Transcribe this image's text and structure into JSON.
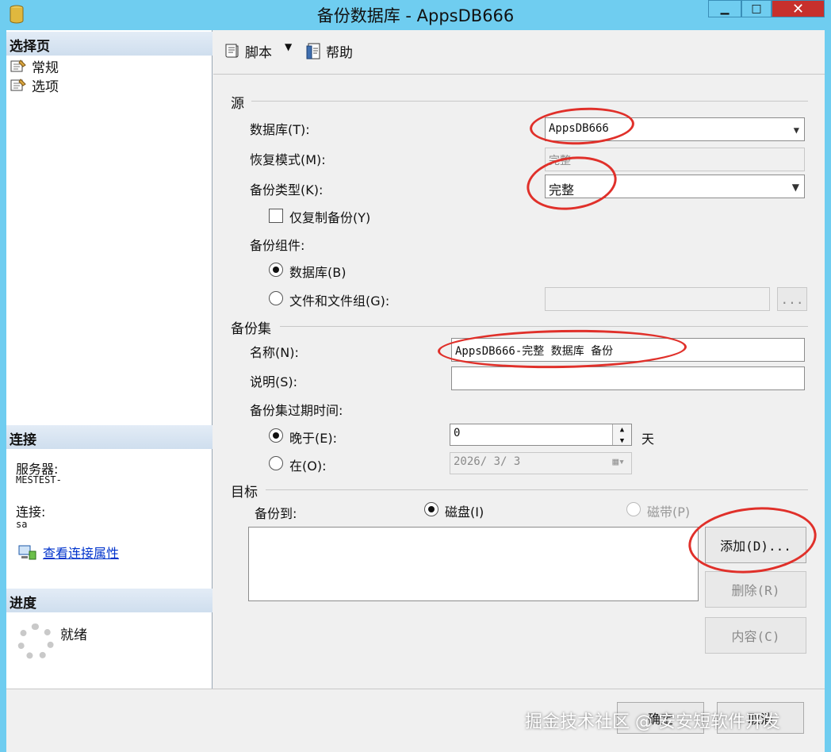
{
  "window": {
    "title": "备份数据库 - AppsDB666"
  },
  "left": {
    "select_page_header": "选择页",
    "nav": [
      {
        "label": "常规"
      },
      {
        "label": "选项"
      }
    ],
    "connection_header": "连接",
    "server_label": "服务器:",
    "server_value": "MESTEST-",
    "conn_label": "连接:",
    "conn_value": "sa",
    "view_conn_props": "查看连接属性",
    "progress_header": "进度",
    "progress_status": "就绪"
  },
  "toolbar": {
    "script": "脚本",
    "help": "帮助"
  },
  "source": {
    "title": "源",
    "database_label": "数据库(T):",
    "database_value": "AppsDB666",
    "recovery_label": "恢复模式(M):",
    "recovery_value": "完整",
    "backup_type_label": "备份类型(K):",
    "backup_type_value": "完整",
    "copy_only_label": "仅复制备份(Y)",
    "component_label": "备份组件:",
    "component_db": "数据库(B)",
    "component_files": "文件和文件组(G):",
    "browse": "..."
  },
  "backupset": {
    "title": "备份集",
    "name_label": "名称(N):",
    "name_value": "AppsDB666-完整 数据库 备份",
    "desc_label": "说明(S):",
    "desc_value": "",
    "expire_label": "备份集过期时间:",
    "after_label": "晚于(E):",
    "after_value": "0",
    "after_unit": "天",
    "on_label": "在(O):",
    "on_value": "2026/ 3/ 3"
  },
  "destination": {
    "title": "目标",
    "backup_to_label": "备份到:",
    "disk_label": "磁盘(I)",
    "tape_label": "磁带(P)",
    "add_button": "添加(D)...",
    "remove_button": "删除(R)",
    "contents_button": "内容(C)"
  },
  "footer": {
    "ok": "确定",
    "cancel": "取消",
    "watermark": "掘金技术社区 @ 安安短软件开发"
  },
  "colors": {
    "annotation": "#e0302a",
    "titlebar": "#6fcdf0",
    "link": "#0033cc"
  }
}
